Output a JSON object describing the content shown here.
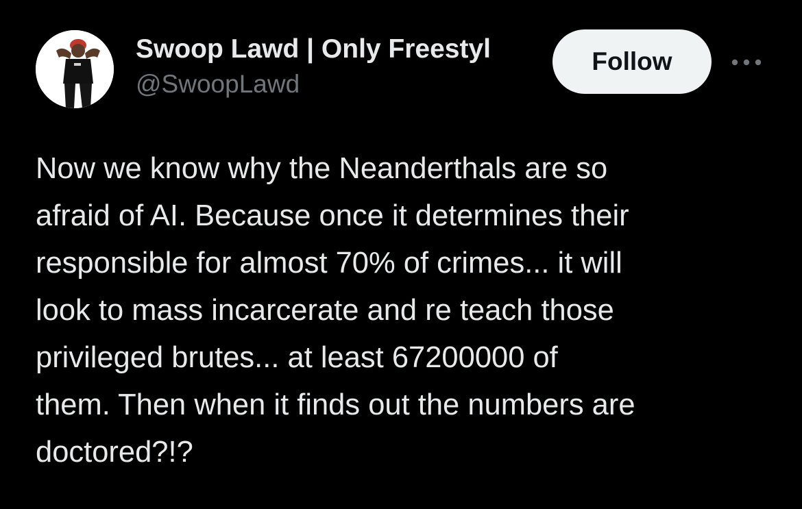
{
  "author": {
    "display_name": "Swoop Lawd | Only Freestyl",
    "handle": "@SwoopLawd",
    "avatar_icon": "user-photo"
  },
  "actions": {
    "follow_label": "Follow",
    "more_icon": "more-horizontal-icon"
  },
  "tweet": {
    "text": "Now we know why the Neanderthals are so\nafraid of AI. Because once it determines their\nresponsible for almost 70% of crimes... it will\nlook to mass incarcerate and re teach those\nprivileged brutes... at least 67200000 of\nthem. Then when it finds out the numbers are\ndoctored?!?"
  },
  "colors": {
    "background": "#000000",
    "primary_text": "#e7e9ea",
    "secondary_text": "#71767b",
    "follow_bg": "#eff3f4",
    "follow_text": "#0f1419"
  }
}
